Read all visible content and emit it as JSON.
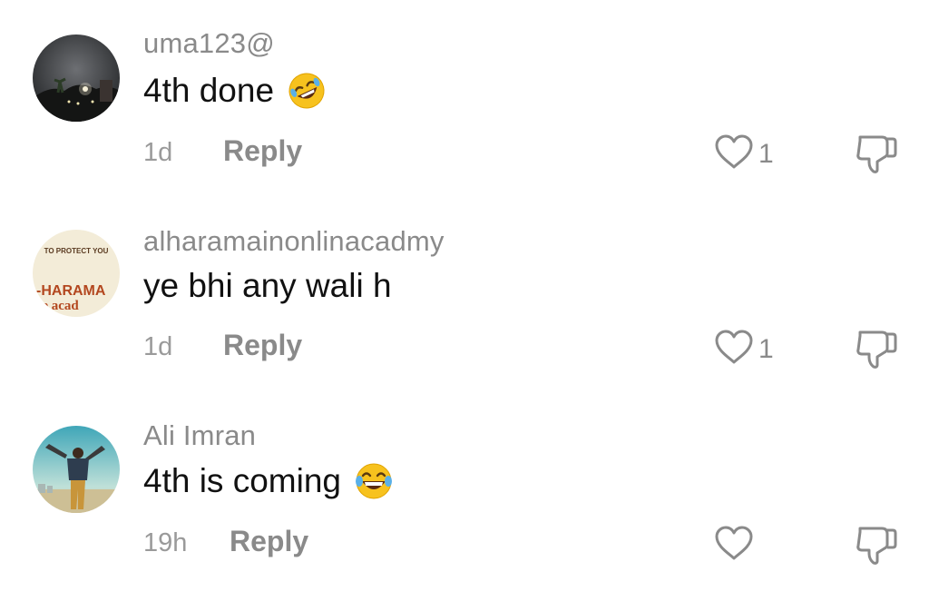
{
  "comments": [
    {
      "username": "uma123@",
      "text": "4th done",
      "emoji": "rolling-on-floor-laughing-emoji",
      "time": "1d",
      "reply_label": "Reply",
      "like_count": "1"
    },
    {
      "username": "alharamainonlinacadmy",
      "text": "ye bhi any wali h",
      "avatar_text": {
        "line1": "TO PROTECT YOU",
        "line2": "-HARAMA",
        "line3": "ne acad"
      },
      "time": "1d",
      "reply_label": "Reply",
      "like_count": "1"
    },
    {
      "username": "Ali Imran",
      "text": "4th is coming",
      "emoji": "face-with-tears-of-joy-emoji",
      "time": "19h",
      "reply_label": "Reply",
      "like_count": ""
    }
  ],
  "colors": {
    "muted": "#8a8a8a",
    "text": "#111111",
    "brand_red": "#b3471f"
  }
}
